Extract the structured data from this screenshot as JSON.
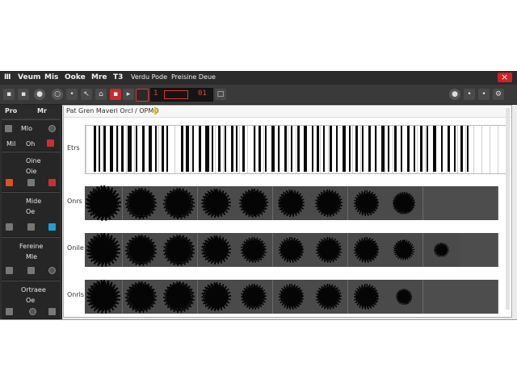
{
  "menubar": {
    "items": [
      "Ⅲ",
      "Veum",
      "Mis",
      "Ooke",
      "Mre",
      "T3",
      "Verdu Pode",
      "Preisine Deue"
    ],
    "close_glyph": "×"
  },
  "toolbar": {
    "lcd_left": "1",
    "lcd_right": "01",
    "icons": [
      "circle-icon",
      "dot-icon",
      "pointer-icon",
      "home-icon",
      "record-icon",
      "stop-icon"
    ]
  },
  "sidebar": {
    "header": [
      "Pro",
      "Mr"
    ],
    "sections": [
      {
        "title": "Mlo",
        "sub": "Oh"
      },
      {
        "title": "Oine",
        "sub": "Oie"
      },
      {
        "title": "Mide",
        "sub": "Oe"
      },
      {
        "title": "Fereine",
        "sub": "Mle"
      },
      {
        "title": "Ortraee",
        "sub": "Oe"
      }
    ]
  },
  "main": {
    "title": "Pat Gren Maveri Orcl / OPMO",
    "piano_label": "Etrs",
    "rows": [
      {
        "label": "Onrs"
      },
      {
        "label": "Onile"
      },
      {
        "label": "Onrls"
      }
    ]
  },
  "colors": {
    "menubar_bg": "#2b2b2b",
    "toolbar_bg": "#3a3a3a",
    "close_red": "#d42020",
    "lcd_red": "#e54040",
    "cell_bg": "#4a4a4a"
  }
}
